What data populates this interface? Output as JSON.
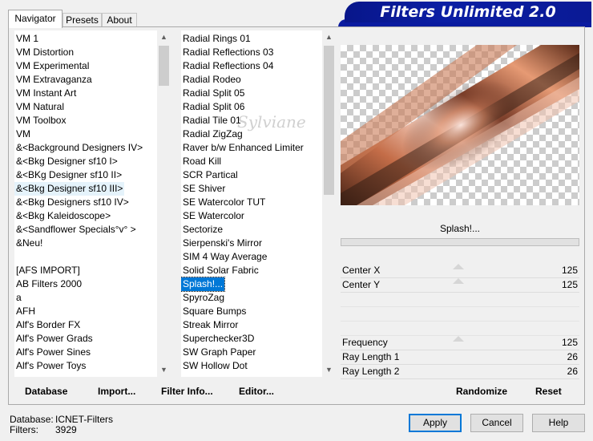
{
  "tabs": [
    "Navigator",
    "Presets",
    "About"
  ],
  "title": "Filters Unlimited 2.0",
  "categories": [
    "VM 1",
    "VM Distortion",
    "VM Experimental",
    "VM Extravaganza",
    "VM Instant Art",
    "VM Natural",
    "VM Toolbox",
    "VM",
    "&<Background Designers IV>",
    "&<Bkg Designer sf10 I>",
    "&<BKg Designer sf10 II>",
    "&<Bkg Designer sf10 III>",
    "&<Bkg Designers sf10 IV>",
    "&<Bkg Kaleidoscope>",
    "&<Sandflower Specials°v° >",
    "&Neu!",
    "",
    "[AFS IMPORT]",
    "AB Filters 2000",
    "a",
    "AFH",
    "Alf's Border FX",
    "Alf's Power Grads",
    "Alf's Power Sines",
    "Alf's Power Toys"
  ],
  "filters": [
    "Radial  Rings 01",
    "Radial Reflections 03",
    "Radial Reflections 04",
    "Radial Rodeo",
    "Radial Split 05",
    "Radial Split 06",
    "Radial Tile 01",
    "Radial ZigZag",
    "Raver b/w Enhanced Limiter",
    "Road Kill",
    "SCR  Partical",
    "SE Shiver",
    "SE Watercolor TUT",
    "SE Watercolor",
    "Sectorize",
    "Sierpenski's Mirror",
    "SIM 4 Way Average",
    "Solid Solar Fabric",
    "Splash!...",
    "SpyroZag",
    "Square Bumps",
    "Streak Mirror",
    "Superchecker3D",
    "SW Graph Paper",
    "SW Hollow Dot"
  ],
  "selected_category": "&<Bkg Designer sf10 III>",
  "selected_filter": "Splash!...",
  "filter_name": "Splash!...",
  "watermark": "Sylviane",
  "params": {
    "center_x": {
      "label": "Center X",
      "value": "125"
    },
    "center_y": {
      "label": "Center Y",
      "value": "125"
    },
    "frequency": {
      "label": "Frequency",
      "value": "125"
    },
    "ray_length_1": {
      "label": "Ray Length 1",
      "value": "26"
    },
    "ray_length_2": {
      "label": "Ray Length 2",
      "value": "26"
    }
  },
  "toolbar": {
    "database": "Database",
    "import": "Import...",
    "filter_info": "Filter Info...",
    "editor": "Editor...",
    "randomize": "Randomize",
    "reset": "Reset"
  },
  "status": {
    "database_label": "Database:",
    "database_value": "ICNET-Filters",
    "filters_label": "Filters:",
    "filters_value": "3929"
  },
  "buttons": {
    "apply": "Apply",
    "cancel": "Cancel",
    "help": "Help"
  },
  "colors": {
    "selection": "#0078d7",
    "title_banner": "#0b1ea4"
  }
}
